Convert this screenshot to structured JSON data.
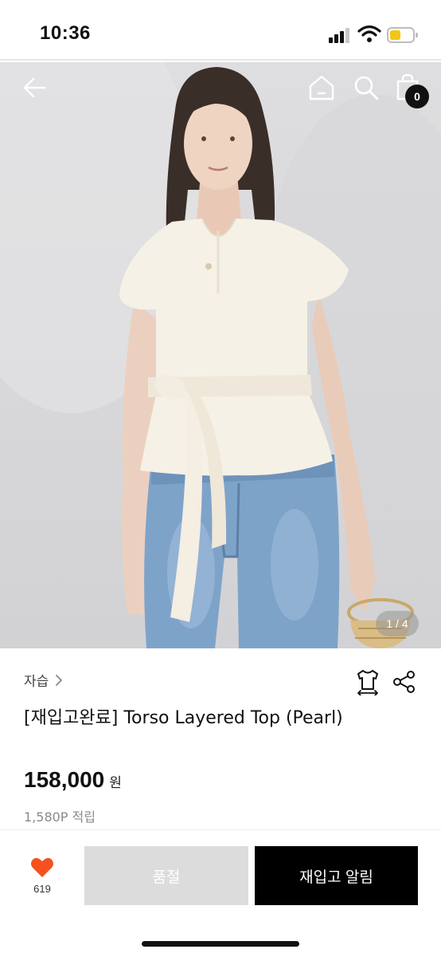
{
  "status_bar": {
    "time": "10:36",
    "icons": [
      "cellular-signal-icon",
      "wifi-icon",
      "battery-icon"
    ],
    "battery_color": "#f5c518"
  },
  "header": {
    "icons": [
      "back-arrow-icon",
      "home-icon",
      "search-icon",
      "shopping-bag-icon"
    ],
    "cart_count": "0"
  },
  "gallery": {
    "page_indicator": "1 / 4"
  },
  "product": {
    "brand": "자습",
    "title": "[재입고완료] Torso Layered Top (Pearl)",
    "price": "158,000",
    "price_unit": "원",
    "points": "1,580P 적립",
    "action_icons": [
      "size-guide-icon",
      "share-icon"
    ]
  },
  "bottom_bar": {
    "wish_count": "619",
    "wish_color": "#f4511e",
    "soldout_label": "품절",
    "restock_label": "재입고 알림"
  }
}
